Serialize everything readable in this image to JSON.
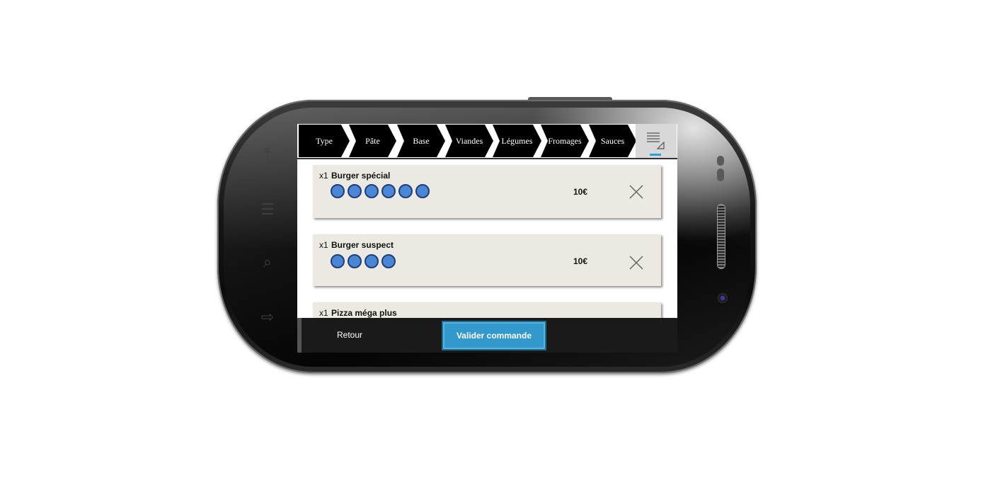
{
  "steps": [
    {
      "label": "Type"
    },
    {
      "label": "Pâte"
    },
    {
      "label": "Base"
    },
    {
      "label": "Viandes"
    },
    {
      "label": "Légumes"
    },
    {
      "label": "Fromages"
    },
    {
      "label": "Sauces"
    }
  ],
  "cart_icon": "order-list-icon",
  "accent_color": "#3399cc",
  "order": [
    {
      "qty": "x1",
      "name": "Burger spécial",
      "ingredient_count": 6,
      "price": "10€"
    },
    {
      "qty": "x1",
      "name": "Burger suspect",
      "ingredient_count": 4,
      "price": "10€"
    },
    {
      "qty": "x1",
      "name": "Pizza méga plus"
    }
  ],
  "footer": {
    "back_label": "Retour",
    "validate_label": "Valider commande"
  }
}
